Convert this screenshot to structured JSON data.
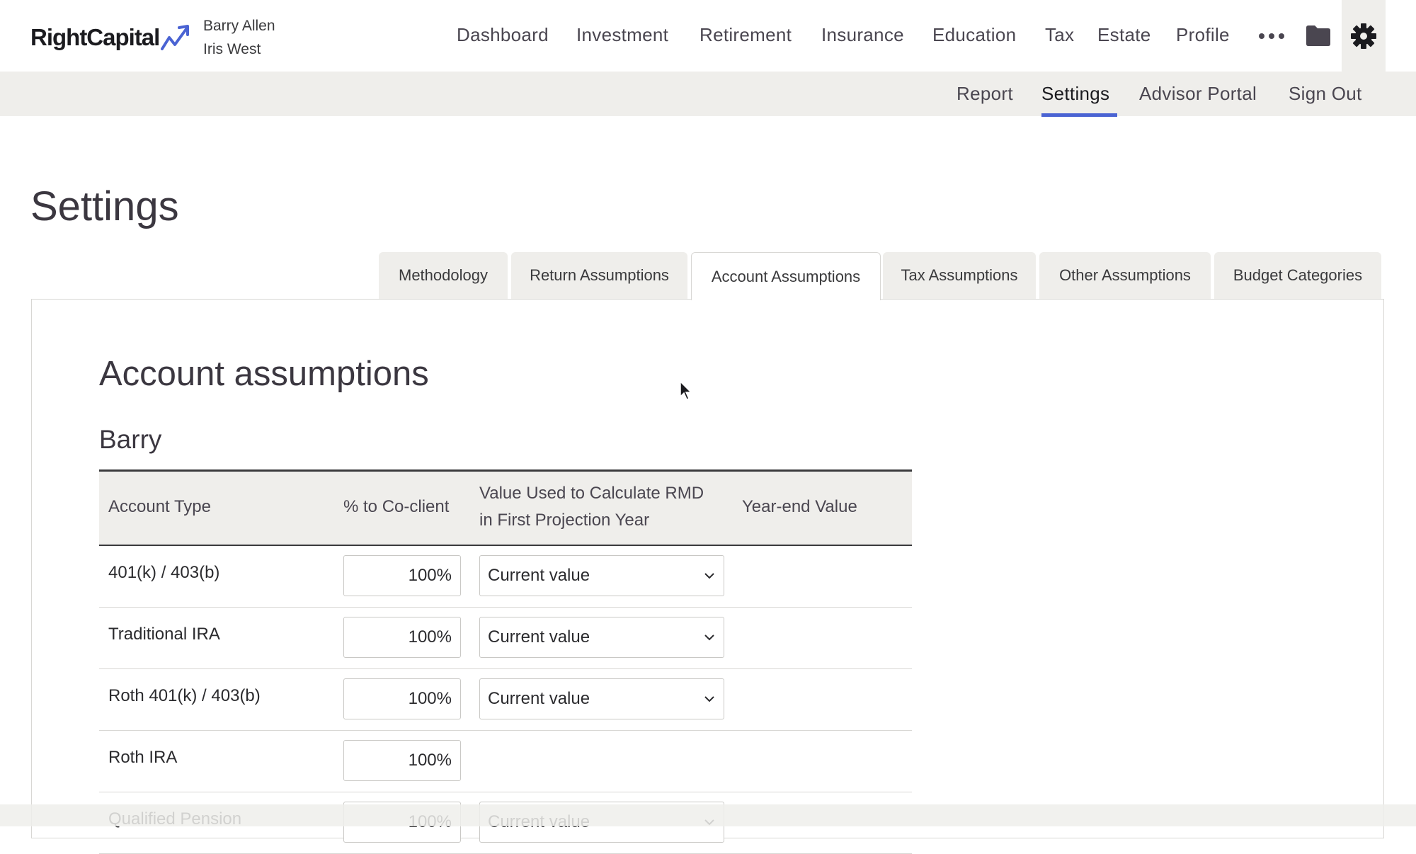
{
  "brand": {
    "name": "RightCapital"
  },
  "clients": [
    "Barry Allen",
    "Iris West"
  ],
  "main_nav": [
    "Dashboard",
    "Investment",
    "Retirement",
    "Insurance",
    "Education",
    "Tax",
    "Estate",
    "Profile"
  ],
  "icons": {
    "more": "more-horizontal-icon",
    "folder": "folder-icon",
    "settings": "gear-icon"
  },
  "sub_nav": {
    "items": [
      "Report",
      "Settings",
      "Advisor Portal",
      "Sign Out"
    ],
    "active": "Settings"
  },
  "page_title": "Settings",
  "tabs": {
    "items": [
      "Methodology",
      "Return Assumptions",
      "Account Assumptions",
      "Tax Assumptions",
      "Other Assumptions",
      "Budget Categories"
    ],
    "active": "Account Assumptions"
  },
  "section": {
    "title": "Account assumptions",
    "person": "Barry",
    "columns": {
      "account_type": "Account Type",
      "pct_co_client": "% to Co-client",
      "rmd_line1": "Value Used to Calculate RMD",
      "rmd_line2": "in First Projection Year",
      "year_end": "Year-end Value"
    },
    "rows": [
      {
        "type": "401(k) / 403(b)",
        "pct": "100%",
        "rmd": "Current value"
      },
      {
        "type": "Traditional IRA",
        "pct": "100%",
        "rmd": "Current value"
      },
      {
        "type": "Roth 401(k) / 403(b)",
        "pct": "100%",
        "rmd": "Current value"
      },
      {
        "type": "Roth IRA",
        "pct": "100%",
        "rmd": ""
      },
      {
        "type": "Qualified Pension",
        "pct": "100%",
        "rmd": "Current value"
      }
    ]
  },
  "colors": {
    "accent": "#4a63d3",
    "bar_bg": "#efeeeb",
    "text": "#3a3a3c"
  }
}
